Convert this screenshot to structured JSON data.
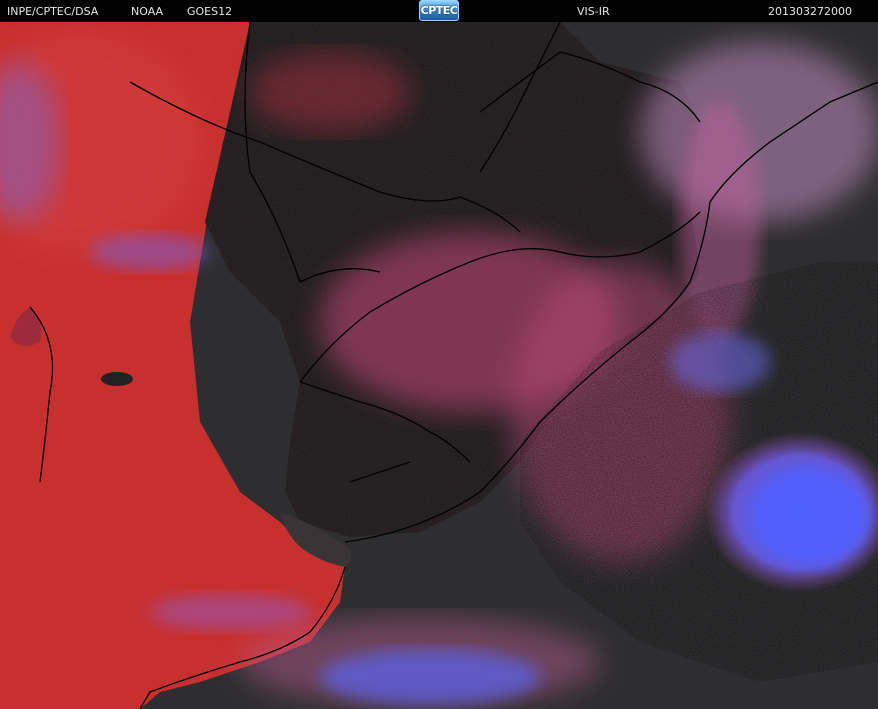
{
  "header": {
    "organization": "INPE/CPTEC/DSA",
    "agency": "NOAA",
    "satellite": "GOES12",
    "channel": "VIS-IR",
    "timestamp": "201303272000"
  },
  "logo": {
    "text": "CPTEC"
  },
  "image": {
    "kind": "satellite-composite",
    "colors": {
      "land_warm": "#c8302f",
      "land_dark": "#2c2628",
      "ocean": "#2e2e2f",
      "cloud_low": "#c84a78",
      "cloud_high": "#5a5ff0",
      "borders": "#000000"
    }
  }
}
